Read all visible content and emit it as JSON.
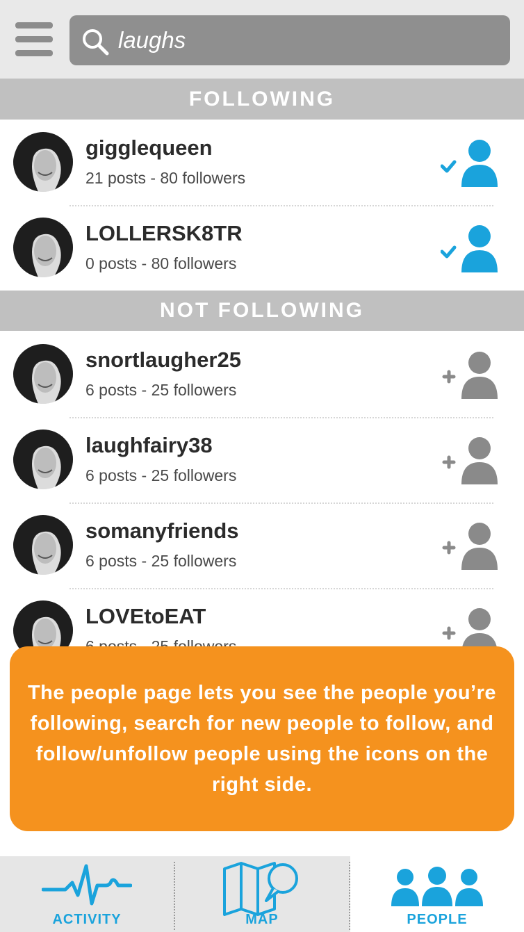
{
  "search": {
    "query": "laughs",
    "icon": "search-icon"
  },
  "sections": {
    "following_label": "FOLLOWING",
    "not_following_label": "NOT FOLLOWING"
  },
  "following": [
    {
      "username": "gigglequeen",
      "stats": "21 posts - 80 followers",
      "status": "following"
    },
    {
      "username": "LOLLERSK8TR",
      "stats": "0 posts - 80 followers",
      "status": "following"
    }
  ],
  "not_following": [
    {
      "username": "snortlaugher25",
      "stats": "6 posts - 25 followers",
      "status": "not-following"
    },
    {
      "username": "laughfairy38",
      "stats": "6 posts - 25 followers",
      "status": "not-following"
    },
    {
      "username": "somanyfriends",
      "stats": "6 posts - 25 followers",
      "status": "not-following"
    },
    {
      "username": "LOVEtoEAT",
      "stats": "6 posts - 25 followers",
      "status": "not-following"
    }
  ],
  "tip": {
    "text": "The people page lets you see the people you’re following, search for new people to follow, and follow/unfollow people using the icons on the right side."
  },
  "nav": {
    "activity_label": "ACTIVITY",
    "map_label": "MAP",
    "people_label": "PEOPLE",
    "active_tab": "people"
  },
  "colors": {
    "accent_blue": "#1aa3dc",
    "orange": "#f5921e",
    "gray_icon": "#8a8a8a",
    "section_bg": "#c0c0c0"
  }
}
